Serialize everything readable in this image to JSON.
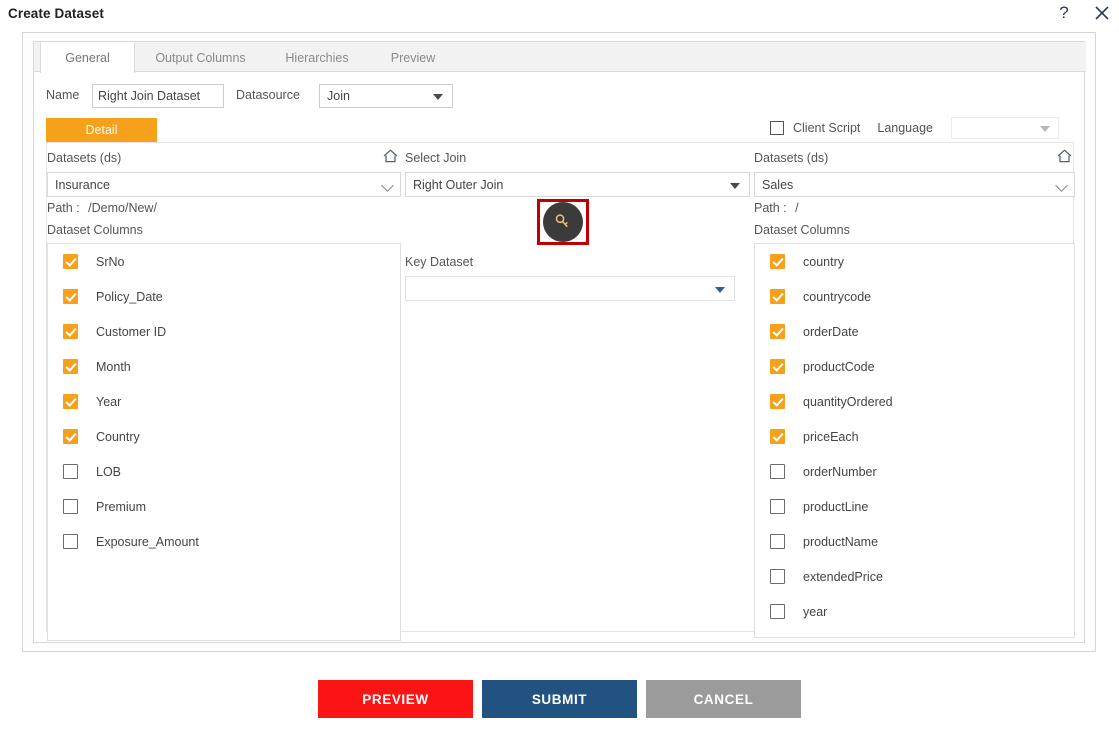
{
  "dialog": {
    "title": "Create Dataset",
    "help_icon": "question-mark-icon",
    "close_icon": "close-icon"
  },
  "tabs": [
    {
      "label": "General",
      "active": true
    },
    {
      "label": "Output Columns",
      "active": false
    },
    {
      "label": "Hierarchies",
      "active": false
    },
    {
      "label": "Preview",
      "active": false
    }
  ],
  "form": {
    "name_label": "Name",
    "name_value": "Right Join Dataset",
    "name_placeholder": "",
    "datasource_label": "Datasource",
    "datasource_value": "Join"
  },
  "options": {
    "client_script_label": "Client Script",
    "client_script_checked": false,
    "language_label": "Language",
    "language_value": ""
  },
  "detail_tab": {
    "label": "Detail"
  },
  "left_panel": {
    "datasets_label": "Datasets (ds)",
    "home_icon": "home-icon",
    "dataset_value": "Insurance",
    "path_label": "Path :",
    "path_value": "/Demo/New/",
    "columns_label": "Dataset Columns",
    "columns": [
      {
        "name": "SrNo",
        "checked": true
      },
      {
        "name": "Policy_Date",
        "checked": true
      },
      {
        "name": "Customer ID",
        "checked": true
      },
      {
        "name": "Month",
        "checked": true
      },
      {
        "name": "Year",
        "checked": true
      },
      {
        "name": "Country",
        "checked": true
      },
      {
        "name": "LOB",
        "checked": false
      },
      {
        "name": "Premium",
        "checked": false
      },
      {
        "name": "Exposure_Amount",
        "checked": false
      }
    ]
  },
  "middle_panel": {
    "select_join_label": "Select Join",
    "select_join_value": "Right Outer Join",
    "key_icon": "key-icon",
    "key_dataset_label": "Key Dataset",
    "key_dataset_value": ""
  },
  "right_panel": {
    "datasets_label": "Datasets (ds)",
    "home_icon": "home-icon",
    "dataset_value": "Sales",
    "path_label": "Path :",
    "path_value": "/",
    "columns_label": "Dataset Columns",
    "columns": [
      {
        "name": "country",
        "checked": true
      },
      {
        "name": "countrycode",
        "checked": true
      },
      {
        "name": "orderDate",
        "checked": true
      },
      {
        "name": "productCode",
        "checked": true
      },
      {
        "name": "quantityOrdered",
        "checked": true
      },
      {
        "name": "priceEach",
        "checked": true
      },
      {
        "name": "orderNumber",
        "checked": false
      },
      {
        "name": "productLine",
        "checked": false
      },
      {
        "name": "productName",
        "checked": false
      },
      {
        "name": "extendedPrice",
        "checked": false
      },
      {
        "name": "year",
        "checked": false
      },
      {
        "name": "",
        "checked": false
      }
    ]
  },
  "footer": {
    "preview_label": "PREVIEW",
    "submit_label": "SUBMIT",
    "cancel_label": "CANCEL"
  },
  "colors": {
    "accent_orange": "#f6a01c",
    "preview_red": "#fb1414",
    "submit_blue": "#215280",
    "cancel_grey": "#9b9b9b",
    "highlight_red": "#c00000",
    "key_circle_dark": "#3b3b3b"
  }
}
